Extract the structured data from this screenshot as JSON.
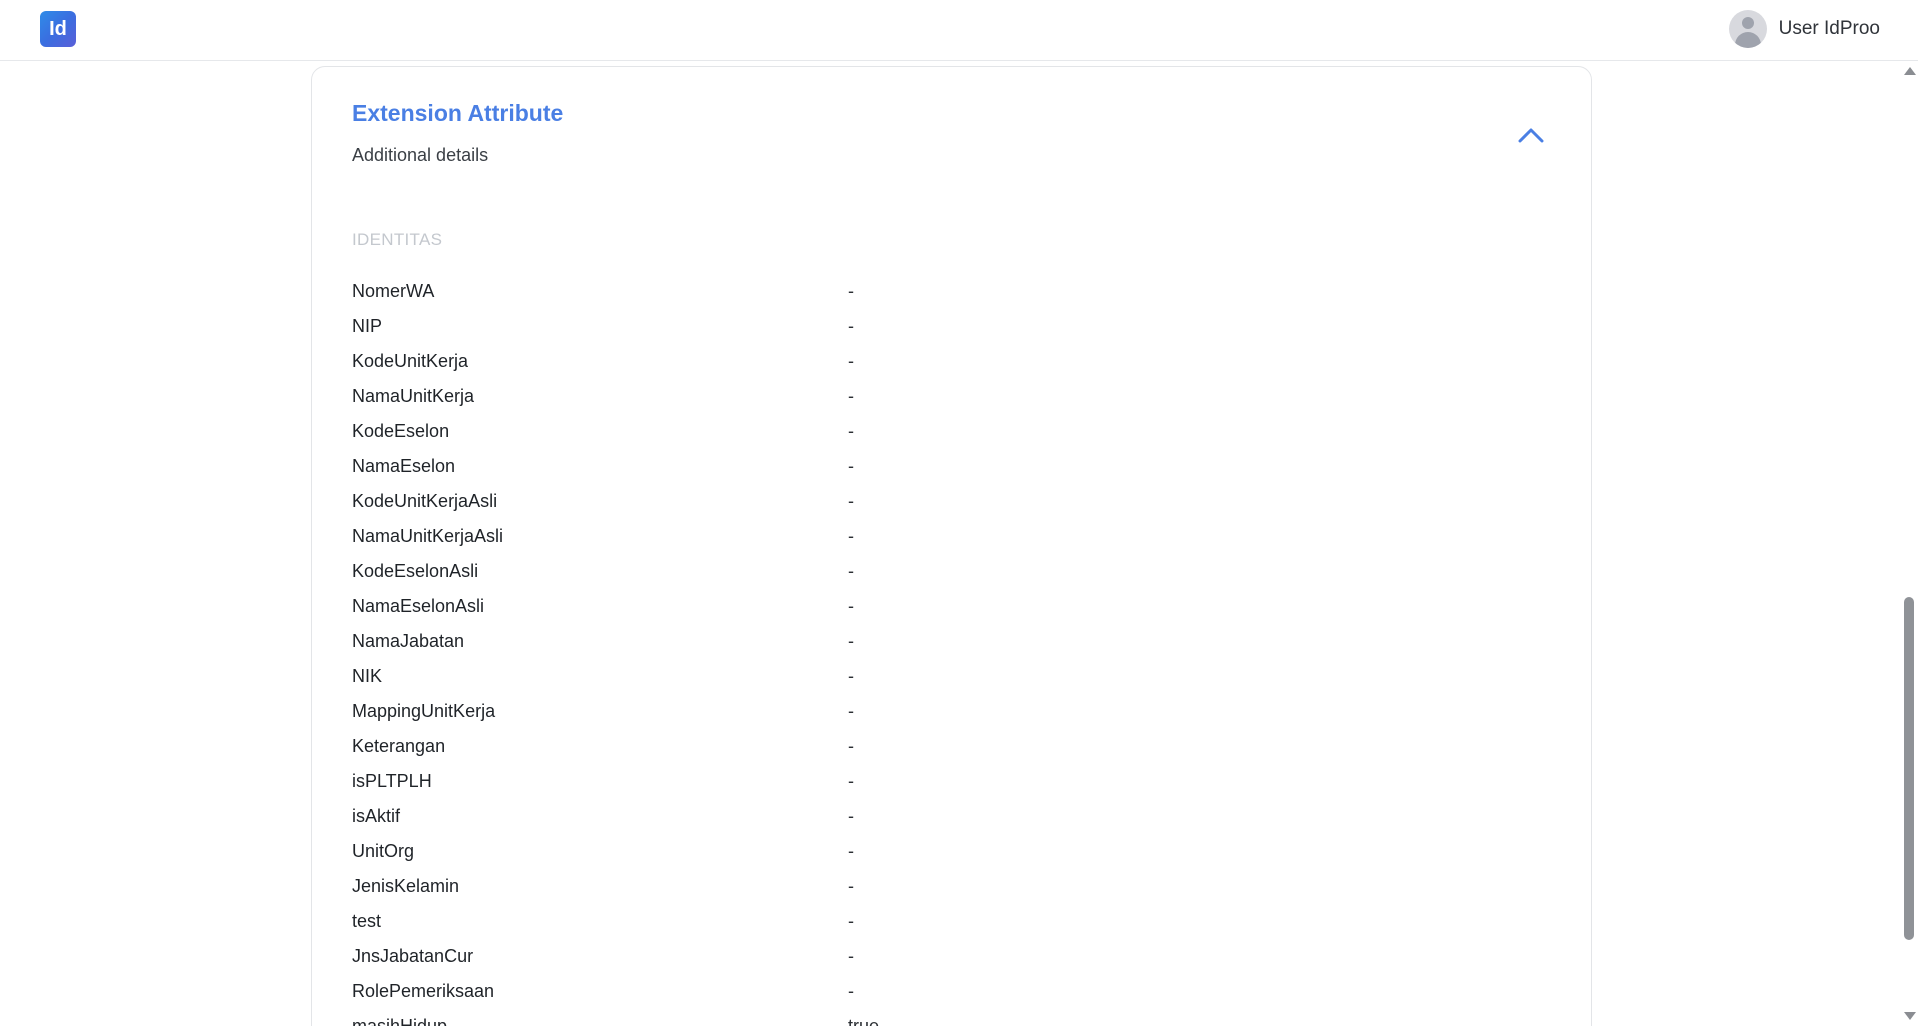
{
  "header": {
    "logo_text": "Id",
    "user_name": "User IdProo"
  },
  "card": {
    "title": "Extension Attribute",
    "subtitle": "Additional details",
    "collapse_icon": "chevron-up-icon",
    "section_label": "IDENTITAS",
    "attributes": [
      {
        "key": "NomerWA",
        "value": "-"
      },
      {
        "key": "NIP",
        "value": "-"
      },
      {
        "key": "KodeUnitKerja",
        "value": "-"
      },
      {
        "key": "NamaUnitKerja",
        "value": "-"
      },
      {
        "key": "KodeEselon",
        "value": "-"
      },
      {
        "key": "NamaEselon",
        "value": "-"
      },
      {
        "key": "KodeUnitKerjaAsli",
        "value": "-"
      },
      {
        "key": "NamaUnitKerjaAsli",
        "value": "-"
      },
      {
        "key": "KodeEselonAsli",
        "value": "-"
      },
      {
        "key": "NamaEselonAsli",
        "value": "-"
      },
      {
        "key": "NamaJabatan",
        "value": "-"
      },
      {
        "key": "NIK",
        "value": "-"
      },
      {
        "key": "MappingUnitKerja",
        "value": "-"
      },
      {
        "key": "Keterangan",
        "value": "-"
      },
      {
        "key": "isPLTPLH",
        "value": "-"
      },
      {
        "key": "isAktif",
        "value": "-"
      },
      {
        "key": "UnitOrg",
        "value": "-"
      },
      {
        "key": "JenisKelamin",
        "value": "-"
      },
      {
        "key": "test",
        "value": "-"
      },
      {
        "key": "JnsJabatanCur",
        "value": "-"
      },
      {
        "key": "RolePemeriksaan",
        "value": "-"
      },
      {
        "key": "masihHidup",
        "value": "true"
      }
    ]
  },
  "colors": {
    "accent": "#4a7fe4",
    "section_label": "#c4c8ce"
  }
}
